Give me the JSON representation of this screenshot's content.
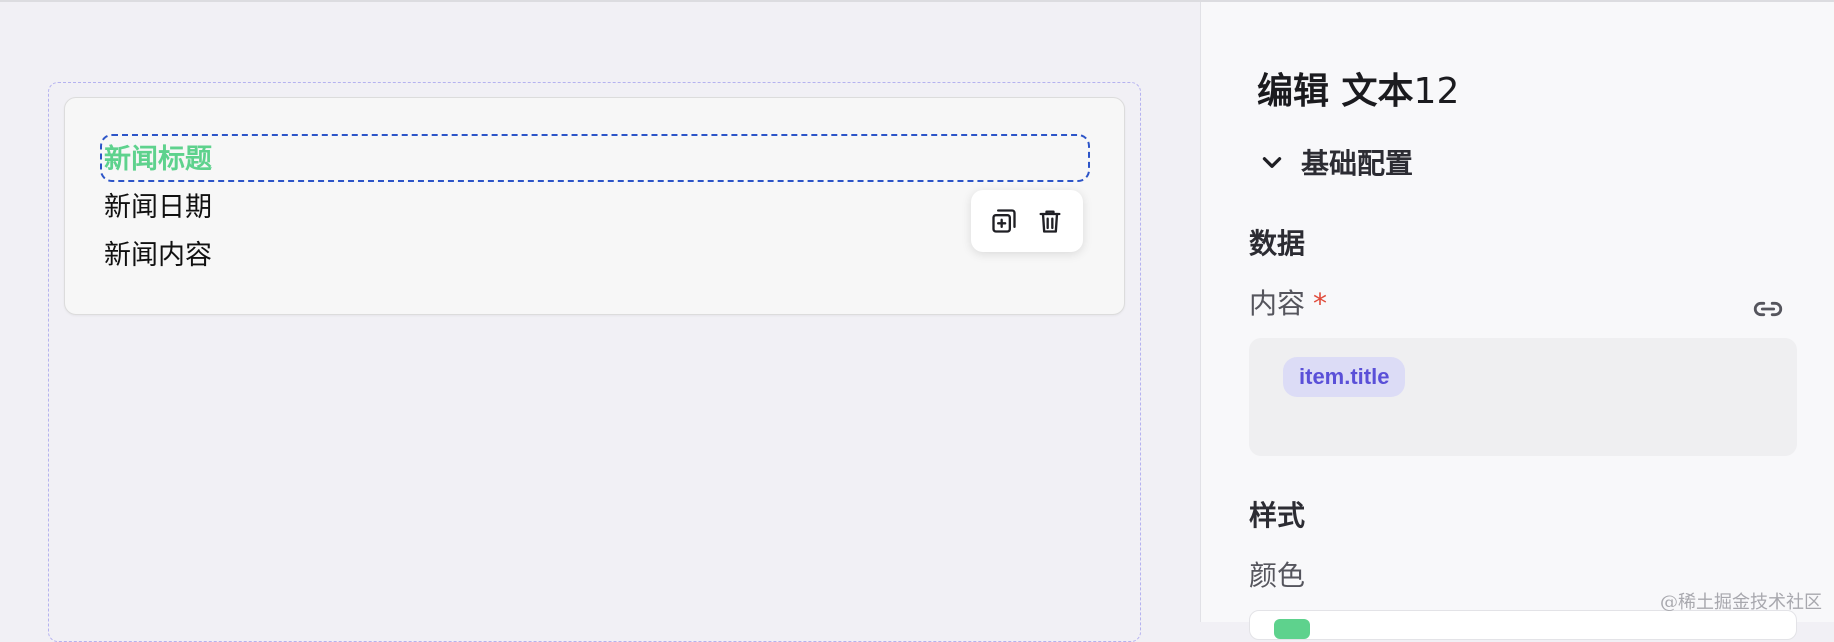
{
  "canvas": {
    "items": [
      {
        "label": "新闻标题",
        "color": "#5ed28d",
        "selected": true
      },
      {
        "label": "新闻日期"
      },
      {
        "label": "新闻内容"
      }
    ],
    "toolbar": {
      "icons": [
        "copy-plus-icon",
        "trash-icon"
      ]
    }
  },
  "panel": {
    "title_prefix": "编辑 文本",
    "title_number": "12",
    "section": {
      "label": "基础配置",
      "icon": "chevron-down-icon",
      "expanded": true
    },
    "data_group": "数据",
    "content_field": {
      "label": "内容",
      "required_mark": "*",
      "token": "item.title",
      "link_icon": "link-icon"
    },
    "style_group": "样式",
    "color_field": {
      "label": "颜色",
      "value": "#5ed28d"
    }
  },
  "watermark": "@稀土掘金技术社区",
  "colors": {
    "accent": "#5a50d8",
    "selection_border": "#2d55c8",
    "dashed_container": "#b5b2f0",
    "required": "#e04a3a"
  }
}
